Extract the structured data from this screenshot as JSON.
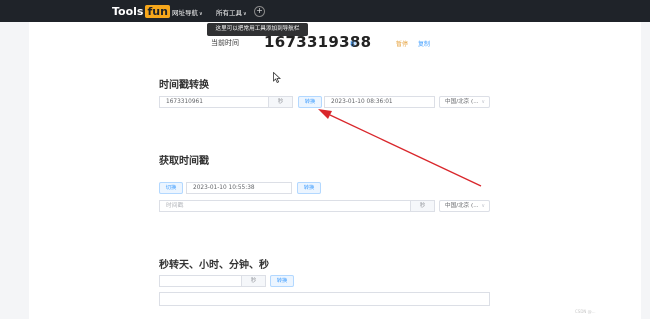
{
  "nav": {
    "logo_text": "Tools",
    "logo_badge": "fun",
    "menu_nav": "网址导航",
    "menu_tools": "所有工具",
    "plus": "+",
    "tooltip": "这里可以把常用工具添加到导航栏"
  },
  "current": {
    "label": "当前时间",
    "timestamp": "1673319388",
    "unit": "秒",
    "pause": "暂停",
    "copy": "复制"
  },
  "convert": {
    "title": "时间戳转换",
    "ts_value": "1673310961",
    "unit": "秒",
    "button": "转换",
    "result": "2023-01-10 08:36:01",
    "timezone": "中国/北京 (..."
  },
  "get": {
    "title": "获取时间戳",
    "switch_button": "切换",
    "datetime": "2023-01-10 10:55:38",
    "button": "转换",
    "placeholder": "时间戳",
    "unit": "秒",
    "timezone": "中国/北京 (..."
  },
  "seconds": {
    "title": "秒转天、小时、分钟、秒",
    "unit": "秒",
    "button": "转换"
  },
  "colors": {
    "accent": "#409eff",
    "logo": "#f7a71b",
    "navbar": "#1f2329",
    "annotation_arrow": "#d9262b"
  }
}
